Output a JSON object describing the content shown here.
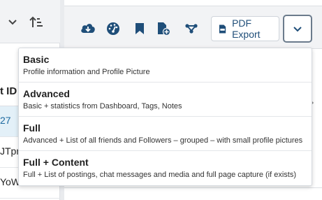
{
  "left_panel": {
    "column_header": "t ID",
    "rows": [
      "27",
      "JTpr",
      "YoW"
    ]
  },
  "toolbar": {
    "icons": [
      "cloud-download-icon",
      "dashboard-icon",
      "bookmark-icon",
      "file-add-icon",
      "share-network-icon"
    ],
    "pdf_export_label": "PDF Export",
    "accent_color": "#1f4e79"
  },
  "menu": {
    "items": [
      {
        "title": "Basic",
        "description": "Profile information and Profile Picture"
      },
      {
        "title": "Advanced",
        "description": "Basic + statistics from Dashboard, Tags, Notes"
      },
      {
        "title": "Full",
        "description": "Advanced + List of all friends and Followers – grouped – with small profile pictures"
      },
      {
        "title": "Full + Content",
        "description": "Full + List of postings, chat messages and media and full page capture (if exists)"
      }
    ]
  }
}
